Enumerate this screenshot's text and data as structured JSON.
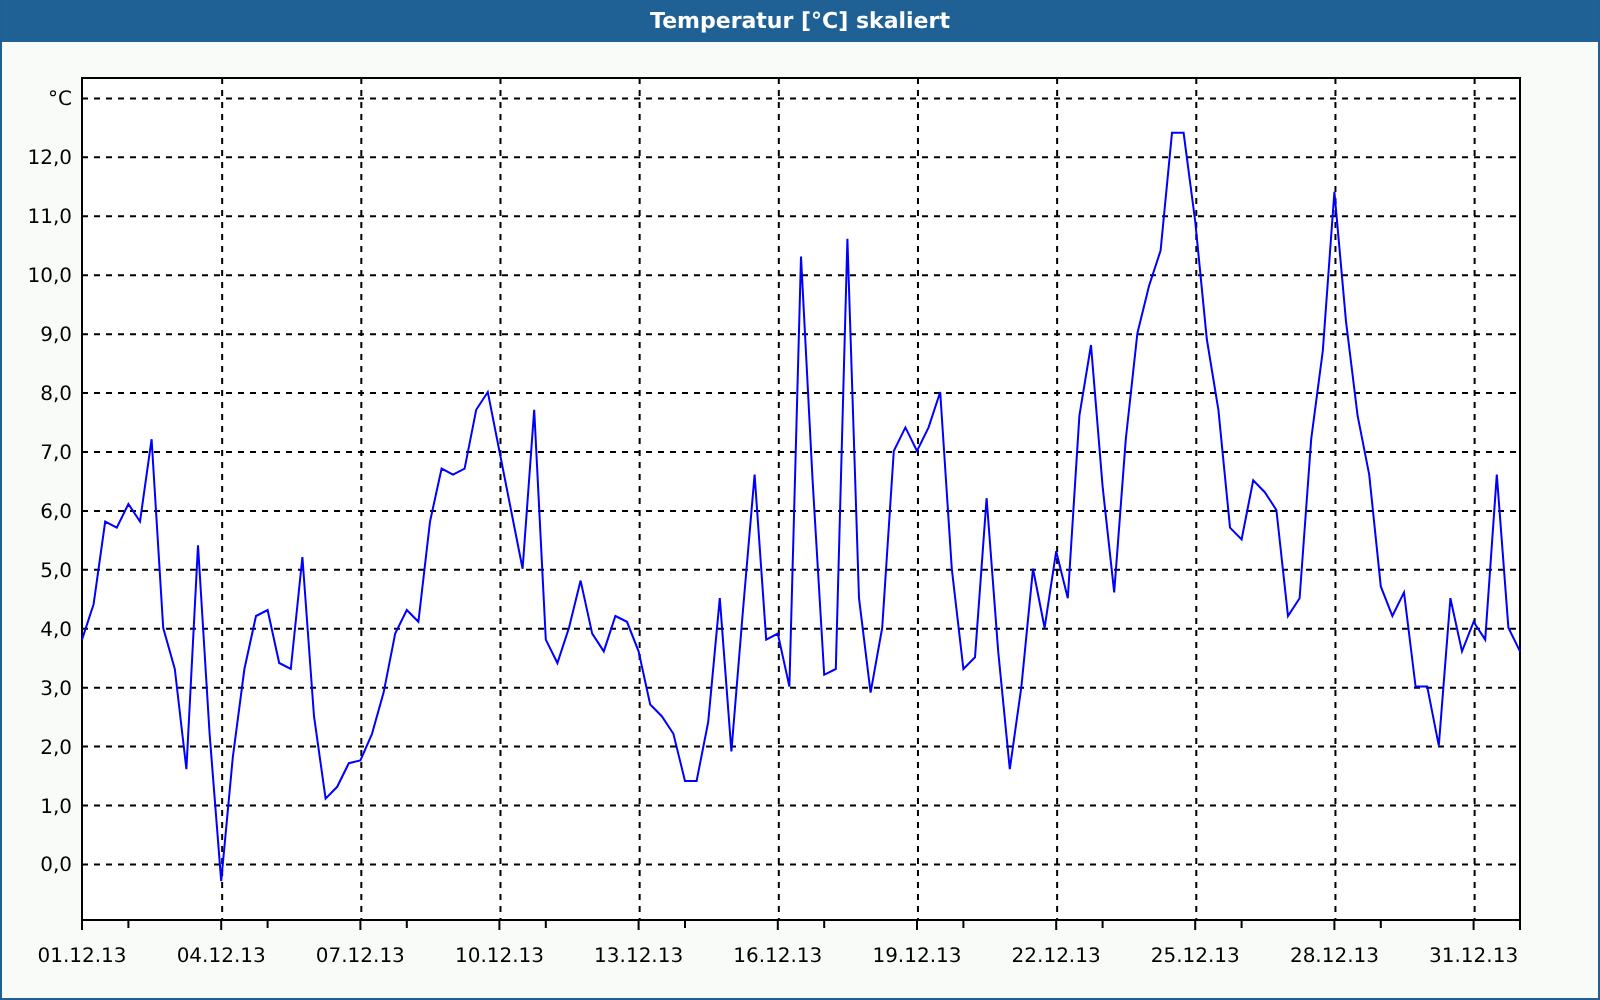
{
  "chart_data": {
    "type": "line",
    "title": "Temperatur [°C] skaliert",
    "grid": true,
    "ylim": [
      -0.96,
      13.33
    ],
    "yticks": [
      {
        "value": 0,
        "label": "0,0"
      },
      {
        "value": 1,
        "label": "1,0"
      },
      {
        "value": 2,
        "label": "2,0"
      },
      {
        "value": 3,
        "label": "3,0"
      },
      {
        "value": 4,
        "label": "4,0"
      },
      {
        "value": 5,
        "label": "5,0"
      },
      {
        "value": 6,
        "label": "6,0"
      },
      {
        "value": 7,
        "label": "7,0"
      },
      {
        "value": 8,
        "label": "8,0"
      },
      {
        "value": 9,
        "label": "9,0"
      },
      {
        "value": 10,
        "label": "10,0"
      },
      {
        "value": 11,
        "label": "11,0"
      },
      {
        "value": 12,
        "label": "12,0"
      },
      {
        "value": 13,
        "label": "°C"
      }
    ],
    "categories": [
      "01.12.13",
      null,
      null,
      null,
      null,
      null,
      null,
      null,
      null,
      null,
      null,
      null,
      "04.12.13",
      null,
      null,
      null,
      null,
      null,
      null,
      null,
      null,
      null,
      null,
      null,
      "07.12.13",
      null,
      null,
      null,
      null,
      null,
      null,
      null,
      null,
      null,
      null,
      null,
      "10.12.13",
      null,
      null,
      null,
      null,
      null,
      null,
      null,
      null,
      null,
      null,
      null,
      "13.12.13",
      null,
      null,
      null,
      null,
      null,
      null,
      null,
      null,
      null,
      null,
      null,
      "16.12.13",
      null,
      null,
      null,
      null,
      null,
      null,
      null,
      null,
      null,
      null,
      null,
      "19.12.13",
      null,
      null,
      null,
      null,
      null,
      null,
      null,
      null,
      null,
      null,
      null,
      "22.12.13",
      null,
      null,
      null,
      null,
      null,
      null,
      null,
      null,
      null,
      null,
      null,
      "25.12.13",
      null,
      null,
      null,
      null,
      null,
      null,
      null,
      null,
      null,
      null,
      null,
      "28.12.13",
      null,
      null,
      null,
      null,
      null,
      null,
      null,
      null,
      null,
      null,
      null,
      "31.12.13",
      null,
      null,
      null,
      null
    ],
    "series": [
      {
        "color": "#0000ff",
        "values": [
          3.8,
          4.4,
          5.8,
          5.7,
          6.1,
          5.8,
          7.2,
          4.0,
          3.3,
          1.6,
          5.4,
          2.2,
          -0.3,
          1.8,
          3.3,
          4.2,
          4.3,
          3.4,
          3.3,
          5.2,
          2.5,
          1.1,
          1.3,
          1.7,
          1.75,
          2.2,
          2.9,
          3.9,
          4.3,
          4.1,
          5.8,
          6.7,
          6.6,
          6.7,
          7.7,
          8.0,
          7.0,
          6.0,
          5.0,
          7.7,
          3.8,
          3.4,
          4.0,
          4.8,
          3.9,
          3.6,
          4.2,
          4.1,
          3.6,
          2.7,
          2.5,
          2.2,
          1.4,
          1.4,
          2.4,
          4.5,
          1.9,
          4.3,
          6.6,
          3.8,
          3.9,
          3.0,
          10.3,
          6.5,
          3.2,
          3.3,
          10.6,
          4.5,
          2.9,
          4.0,
          7.0,
          7.4,
          7.0,
          7.4,
          8.0,
          5.0,
          3.3,
          3.5,
          6.2,
          3.6,
          1.6,
          3.0,
          5.0,
          4.0,
          5.3,
          4.5,
          7.6,
          8.8,
          6.4,
          4.6,
          7.2,
          9.0,
          9.8,
          10.4,
          12.4,
          12.4,
          10.9,
          8.9,
          7.7,
          5.7,
          5.5,
          6.5,
          6.3,
          6.0,
          4.2,
          4.5,
          7.2,
          8.7,
          11.4,
          9.2,
          7.6,
          6.6,
          4.7,
          4.2,
          4.6,
          3.0,
          3.0,
          2.0,
          4.5,
          3.6,
          4.1,
          3.8,
          6.6,
          4.0,
          3.6
        ]
      }
    ]
  }
}
